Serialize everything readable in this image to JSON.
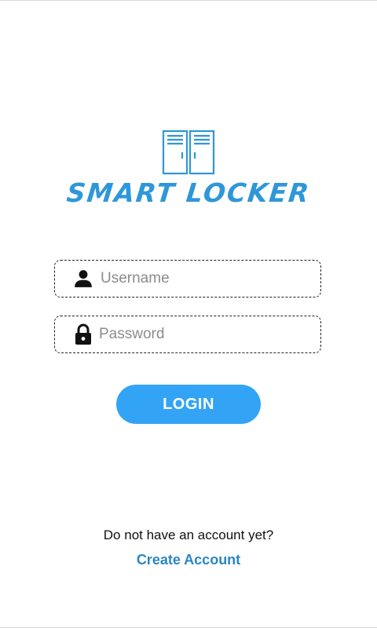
{
  "app": {
    "title": "SMART LOCKER",
    "brand_color": "#2f97d9",
    "logo_icon": "locker-icon"
  },
  "login_form": {
    "username": {
      "icon": "user-icon",
      "placeholder": "Username",
      "value": ""
    },
    "password": {
      "icon": "lock-icon",
      "placeholder": "Password",
      "value": ""
    },
    "login_label": "LOGIN",
    "login_color": "#33a4f5"
  },
  "footer": {
    "prompt": "Do not have an account yet?",
    "create_account_label": "Create Account",
    "link_color": "#2a86c8"
  }
}
